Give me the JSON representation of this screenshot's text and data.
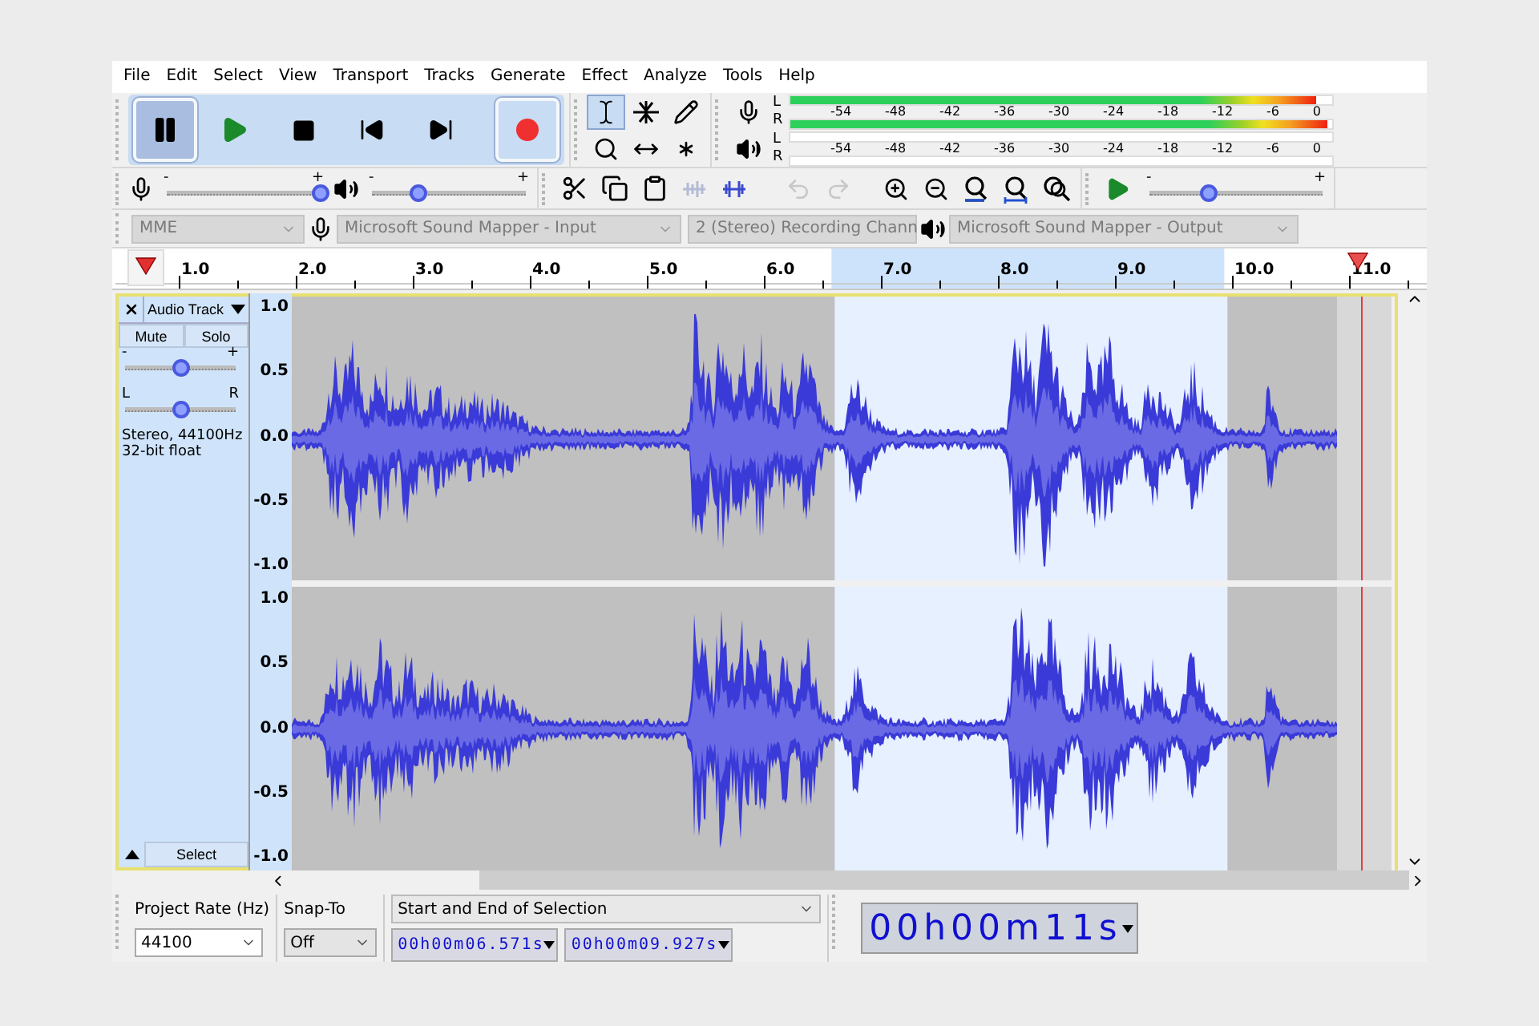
{
  "menu": [
    {
      "label": "File"
    },
    {
      "label": "Edit"
    },
    {
      "label": "Select"
    },
    {
      "label": "View"
    },
    {
      "label": "Transport"
    },
    {
      "label": "Tracks"
    },
    {
      "label": "Generate"
    },
    {
      "label": "Effect"
    },
    {
      "label": "Analyze"
    },
    {
      "label": "Tools"
    },
    {
      "label": "Help"
    }
  ],
  "transport": [
    {
      "kind": "pause",
      "pressed": true
    },
    {
      "kind": "play",
      "pressed": false
    },
    {
      "kind": "stop",
      "pressed": false
    },
    {
      "kind": "skip_start",
      "pressed": false
    },
    {
      "kind": "skip_end",
      "pressed": false
    },
    {
      "kind": "record",
      "pressed": false
    }
  ],
  "tools": [
    {
      "kind": "select",
      "selected": true
    },
    {
      "kind": "envelope",
      "selected": false
    },
    {
      "kind": "draw",
      "selected": false
    },
    {
      "kind": "zoom",
      "selected": false
    },
    {
      "kind": "timeshift",
      "selected": false
    },
    {
      "kind": "multi",
      "selected": false
    }
  ],
  "record_meter": {
    "channels": [
      {
        "label": "L",
        "level": 0.97
      },
      {
        "label": "R",
        "level": 0.99
      }
    ],
    "ticks": [
      "-54",
      "-48",
      "-42",
      "-36",
      "-30",
      "-24",
      "-18",
      "-12",
      "-6",
      "0"
    ]
  },
  "play_meter": {
    "channels": [
      {
        "label": "L"
      },
      {
        "label": "R"
      }
    ],
    "ticks": [
      "-54",
      "-48",
      "-42",
      "-36",
      "-30",
      "-24",
      "-18",
      "-12",
      "-6",
      "0"
    ]
  },
  "mixer": {
    "recording": {
      "min_label": "-",
      "max_label": "+",
      "level": 1.0
    },
    "playback": {
      "min_label": "-",
      "max_label": "+",
      "level": 0.3
    }
  },
  "edit_tools": [
    {
      "kind": "cut",
      "disabled": false
    },
    {
      "kind": "copy",
      "disabled": false
    },
    {
      "kind": "paste",
      "disabled": false
    },
    {
      "kind": "trim",
      "disabled": true
    },
    {
      "kind": "silence",
      "disabled": false
    }
  ],
  "history": [
    {
      "kind": "undo",
      "disabled": true
    },
    {
      "kind": "redo",
      "disabled": true
    }
  ],
  "zoom_tools": [
    {
      "kind": "zoom_in"
    },
    {
      "kind": "zoom_out"
    },
    {
      "kind": "fit_selection"
    },
    {
      "kind": "fit_project"
    },
    {
      "kind": "zoom_toggle"
    }
  ],
  "play_at_speed": {
    "min_label": "-",
    "max_label": "+",
    "level": 0.34
  },
  "devices": {
    "host": "MME",
    "input": "Microsoft Sound Mapper - Input",
    "channels": "2 (Stereo) Recording Chann",
    "output": "Microsoft Sound Mapper - Output"
  },
  "ruler": {
    "labels": [
      "1.0",
      "2.0",
      "3.0",
      "4.0",
      "5.0",
      "6.0",
      "7.0",
      "8.0",
      "9.0",
      "10.0",
      "11.0"
    ]
  },
  "track": {
    "name": "Audio Track",
    "mute": {
      "label": "Mute",
      "on": false
    },
    "solo": {
      "label": "Solo",
      "on": false
    },
    "gain": {
      "min_label": "-",
      "max_label": "+",
      "level": 0.5
    },
    "pan": {
      "min_label": "L",
      "max_label": "R",
      "level": 0.5
    },
    "info": [
      "Stereo, 44100Hz",
      "32-bit float"
    ],
    "select_label": "Select",
    "channels": [
      {
        "axis": [
          "1.0",
          "0.5",
          "0.0",
          "-0.5",
          "-1.0"
        ]
      },
      {
        "axis": [
          "1.0",
          "0.5",
          "0.0",
          "-0.5",
          "-1.0"
        ]
      }
    ]
  },
  "selection_toolbar": {
    "rate_label": "Project Rate (Hz)",
    "rate": "44100",
    "snap_label": "Snap-To",
    "snap": "Off",
    "mode": "Start and End of Selection",
    "start": "00h00m06.571s",
    "end": "00h00m09.927s"
  },
  "audio_position": "00h00m11s"
}
